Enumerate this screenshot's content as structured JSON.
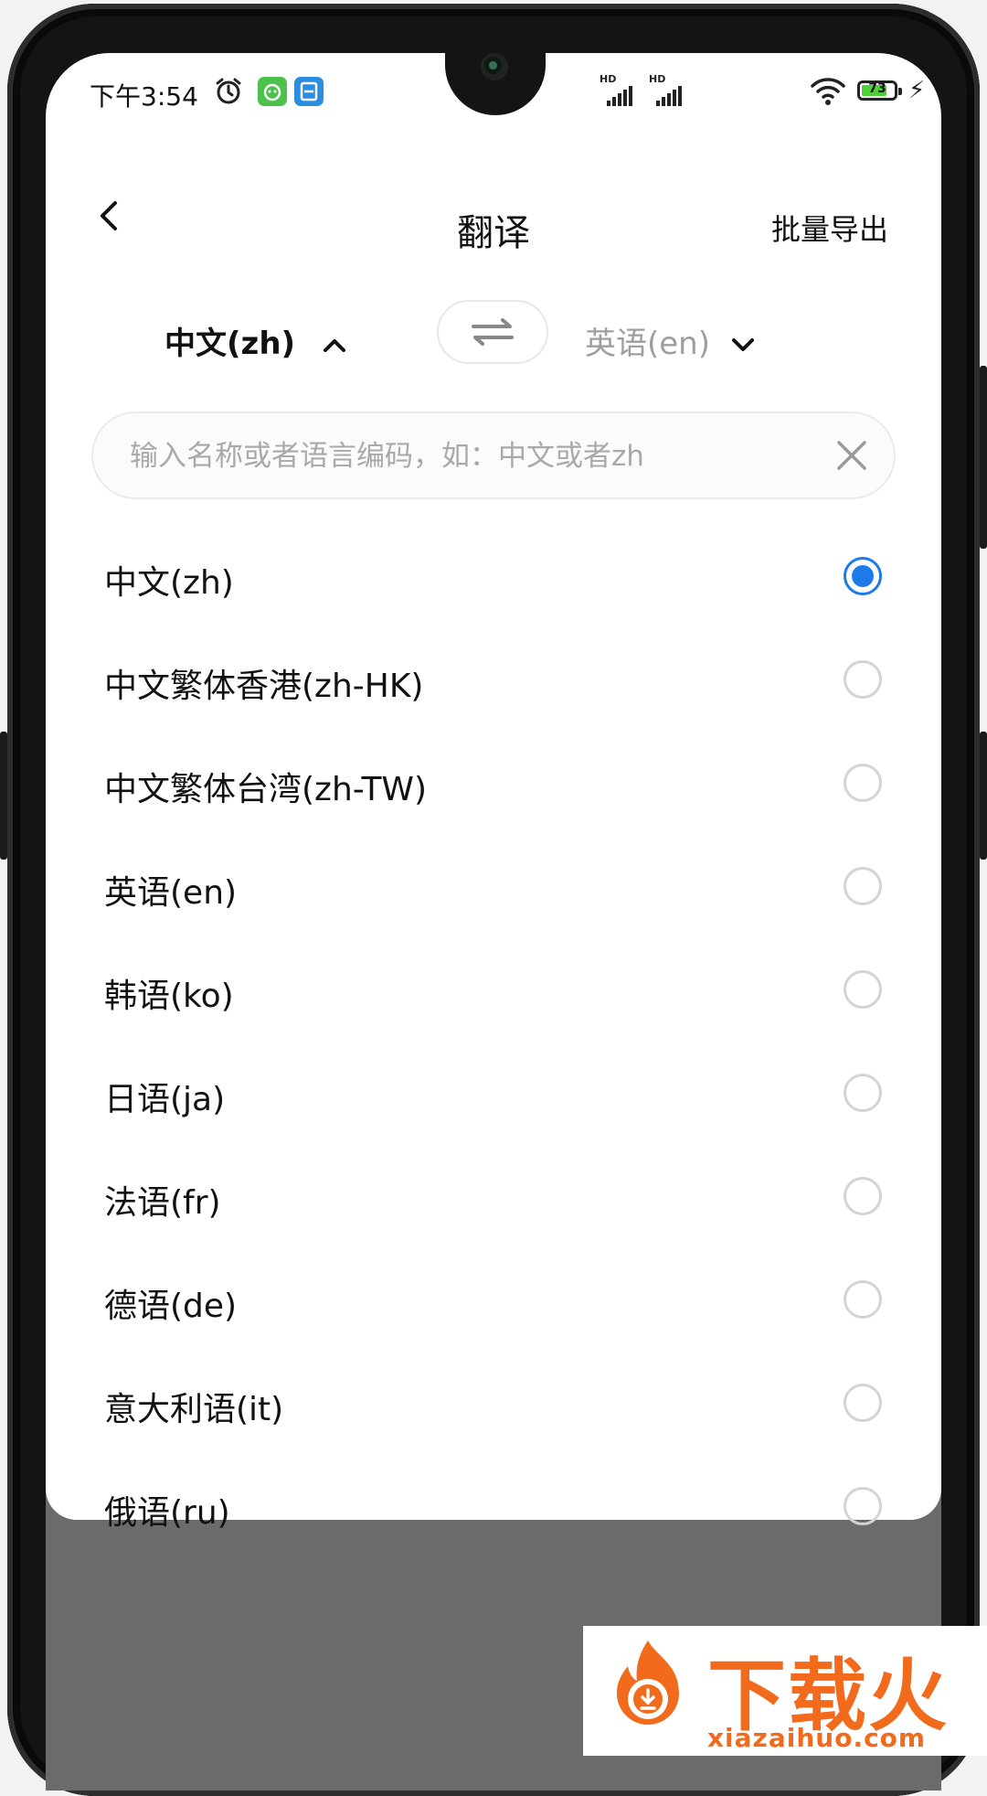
{
  "status_bar": {
    "time": "下午3:54",
    "battery_level": "73",
    "network_label_1": "HD",
    "network_label_2": "HD"
  },
  "header": {
    "title": "翻译",
    "back_icon": "chevron-left-icon",
    "export_label": "批量导出"
  },
  "language_selector": {
    "source_label": "中文(zh)",
    "source_state": "expanded",
    "target_label": "英语(en)",
    "swap_icon": "swap-arrows-icon"
  },
  "search": {
    "placeholder": "输入名称或者语言编码，如：中文或者zh",
    "value": "",
    "clear_icon": "close-icon"
  },
  "languages": [
    {
      "label": "中文(zh)",
      "selected": true
    },
    {
      "label": "中文繁体香港(zh-HK)",
      "selected": false
    },
    {
      "label": "中文繁体台湾(zh-TW)",
      "selected": false
    },
    {
      "label": "英语(en)",
      "selected": false
    },
    {
      "label": "韩语(ko)",
      "selected": false
    },
    {
      "label": "日语(ja)",
      "selected": false
    },
    {
      "label": "法语(fr)",
      "selected": false
    },
    {
      "label": "德语(de)",
      "selected": false
    },
    {
      "label": "意大利语(it)",
      "selected": false
    },
    {
      "label": "俄语(ru)",
      "selected": false
    }
  ],
  "watermark": {
    "brand": "下载火",
    "url": "xiazaihuo.com"
  },
  "colors": {
    "accent": "#1e7ae8",
    "muted_text": "#9e9e9e",
    "watermark": "#f26a1b",
    "overlay": "#6b6b6b"
  }
}
